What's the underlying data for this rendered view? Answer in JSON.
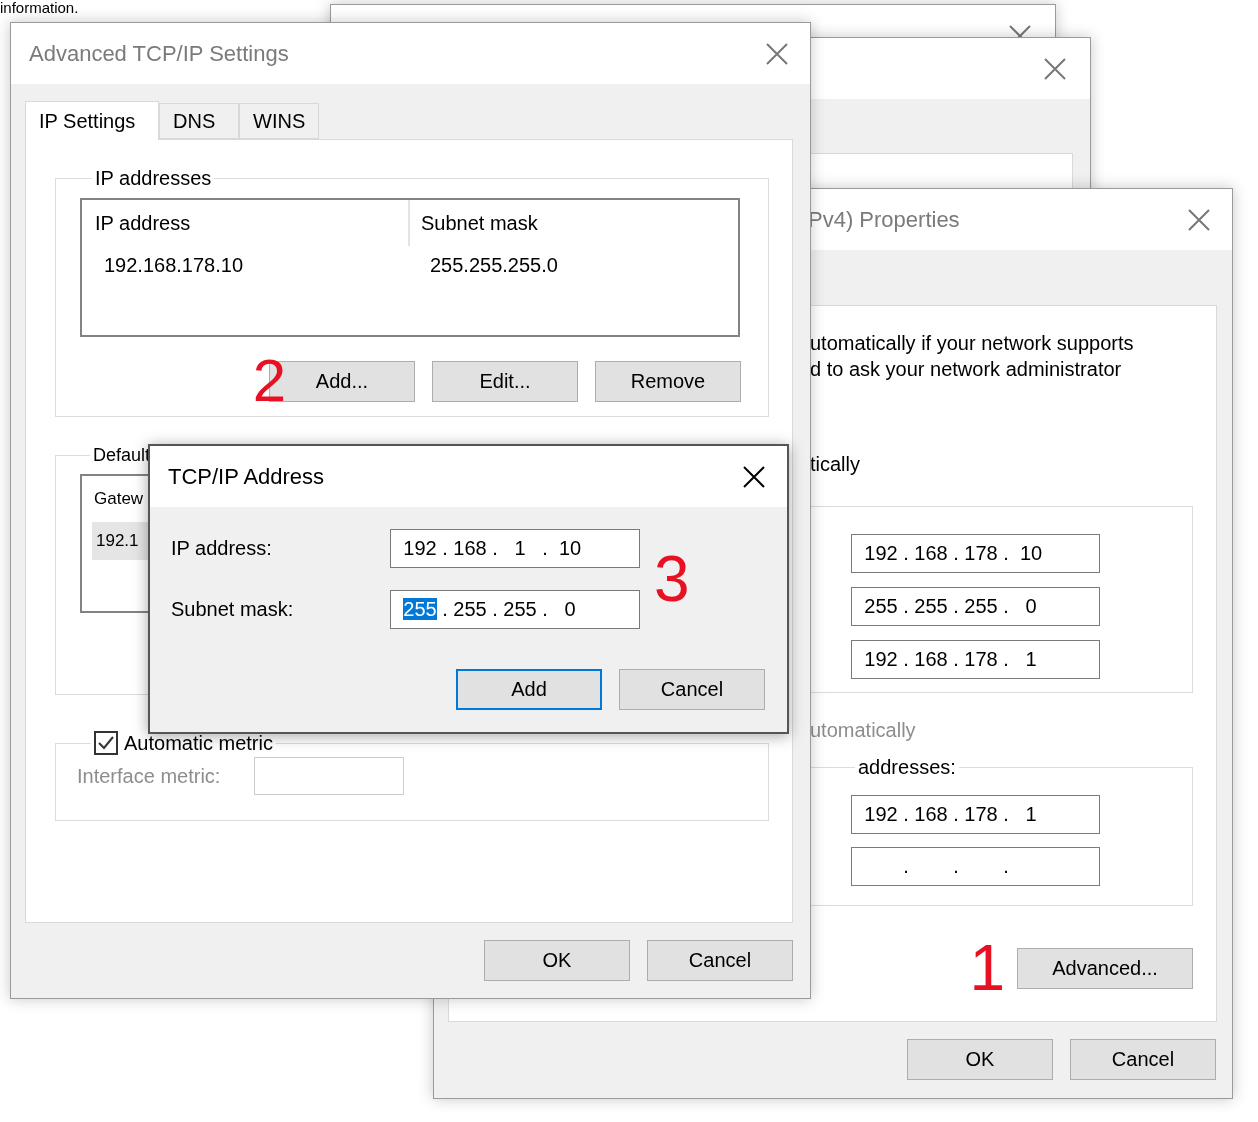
{
  "page_text": "information.",
  "ipv4_window": {
    "title": "Pv4) Properties",
    "active": false,
    "intro": [
      "utomatically if your network supports",
      "d to ask your network administrator"
    ],
    "option_1": "tically",
    "ip_fields": [
      {
        "octets": [
          "192",
          "168",
          "178",
          "10"
        ],
        "separators": [
          ".",
          ".",
          "."
        ]
      },
      {
        "octets": [
          "255",
          "255",
          "255",
          "0"
        ],
        "separators": [
          ".",
          ".",
          "."
        ]
      },
      {
        "octets": [
          "192",
          "168",
          "178",
          "1"
        ],
        "separators": [
          ".",
          ".",
          "."
        ]
      }
    ],
    "option_2": {
      "label": "utomatically",
      "disabled": true
    },
    "dns_group": {
      "label": "addresses:",
      "fields": [
        {
          "octets": [
            "192",
            "168",
            "178",
            "1"
          ],
          "separators": [
            ".",
            ".",
            "."
          ]
        },
        {
          "separators": [
            ".",
            ".",
            "."
          ]
        }
      ]
    },
    "step_marker": "1",
    "advanced_button": "Advanced...",
    "buttons": [
      "OK",
      "Cancel"
    ]
  },
  "advanced_window": {
    "title": "Advanced TCP/IP Settings",
    "active": false,
    "tabs": [
      {
        "label": "IP Settings",
        "selected": true
      },
      {
        "label": "DNS",
        "selected": false
      },
      {
        "label": "WINS",
        "selected": false
      }
    ],
    "ip_group": {
      "label": "IP addresses",
      "columns": [
        "IP address",
        "Subnet mask"
      ],
      "rows": [
        {
          "cells": [
            "192.168.178.10",
            "255.255.255.0"
          ],
          "selected": false
        }
      ],
      "step_marker": "2",
      "buttons": [
        "Add...",
        "Edit...",
        "Remove"
      ]
    },
    "gateway_group": {
      "label": "Default",
      "columns": [
        "Gatew"
      ],
      "rows": [
        {
          "cells": [
            "192.1"
          ],
          "selected": true
        }
      ]
    },
    "metric_group": {
      "checkbox": {
        "label": "Automatic metric",
        "checked": true
      },
      "field": {
        "label": "Interface metric:",
        "disabled": true
      }
    },
    "buttons": [
      "OK",
      "Cancel"
    ]
  },
  "address_dialog": {
    "title": "TCP/IP Address",
    "active": true,
    "fields": [
      {
        "label": "IP address:",
        "octets": [
          {
            "text": "192",
            "selected": false
          },
          {
            "text": "168",
            "selected": false
          },
          {
            "text": "1",
            "selected": false
          },
          {
            "text": "10",
            "selected": false
          }
        ],
        "separators": [
          ".",
          ".",
          "."
        ]
      },
      {
        "label": "Subnet mask:",
        "octets": [
          {
            "text": "255",
            "selected": true
          },
          {
            "text": "255",
            "selected": false
          },
          {
            "text": "255",
            "selected": false
          },
          {
            "text": "0",
            "selected": false
          }
        ],
        "separators": [
          ".",
          ".",
          "."
        ]
      }
    ],
    "step_marker": "3",
    "buttons": [
      {
        "label": "Add",
        "default": true
      },
      {
        "label": "Cancel",
        "default": false
      }
    ]
  }
}
